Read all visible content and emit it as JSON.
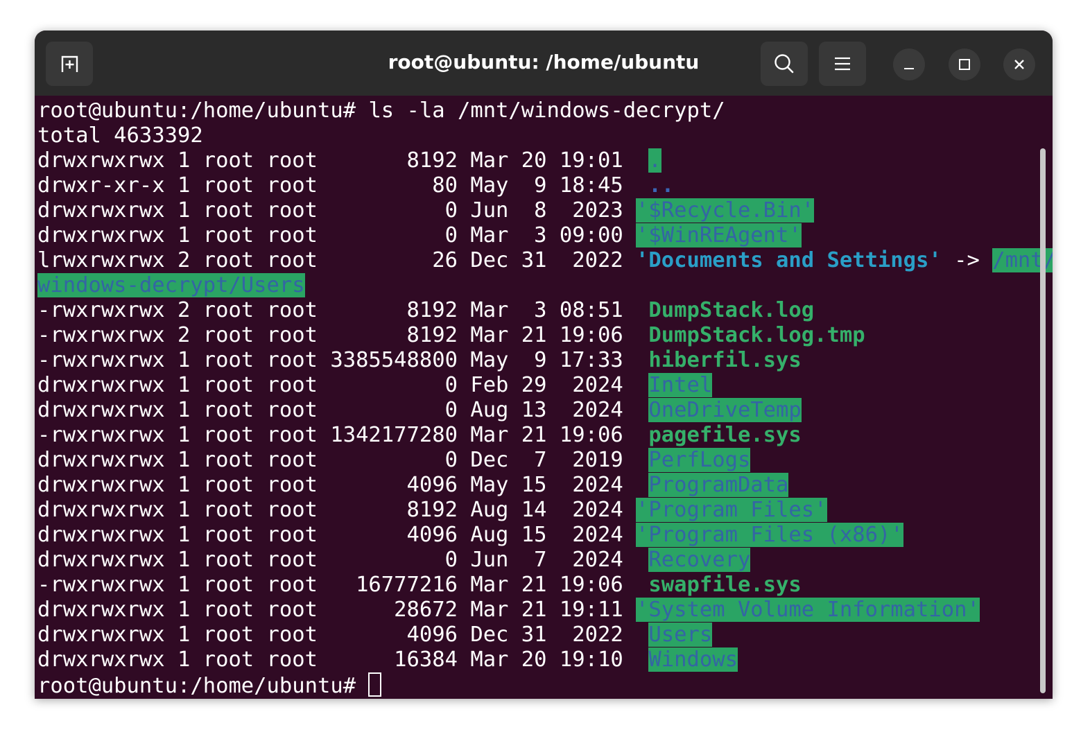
{
  "window": {
    "title": "root@ubuntu: /home/ubuntu",
    "buttons": [
      "new-tab",
      "search",
      "menu",
      "minimize",
      "maximize",
      "close"
    ]
  },
  "terminal": {
    "prompt": "root@ubuntu:/home/ubuntu# ",
    "command": "ls -la /mnt/windows-decrypt/",
    "total": "total 4633392",
    "rows": [
      {
        "meta": "drwxrwxrwx 1 root root       8192 Mar 20 19:01 ",
        "pre": " ",
        "name": ".",
        "style": "d"
      },
      {
        "meta": "drwxr-xr-x 1 root root         80 May  9 18:45 ",
        "pre": " ",
        "name": "..",
        "style": "b"
      },
      {
        "meta": "drwxrwxrwx 1 root root          0 Jun  8  2023 ",
        "pre": "",
        "name": "'$Recycle.Bin'",
        "style": "d"
      },
      {
        "meta": "drwxrwxrwx 1 root root          0 Mar  3 09:00 ",
        "pre": "",
        "name": "'$WinREAgent'",
        "style": "d"
      },
      {
        "meta": "lrwxrwxrwx 2 root root         26 Dec 31  2022 ",
        "pre": "",
        "name": "'Documents and Settings'",
        "style": "l",
        "arrow": " -> ",
        "target1": "/mnt/",
        "target2": "windows-decrypt/Users"
      },
      {
        "meta": "-rwxrwxrwx 2 root root       8192 Mar  3 08:51 ",
        "pre": " ",
        "name": "DumpStack.log",
        "style": "g"
      },
      {
        "meta": "-rwxrwxrwx 2 root root       8192 Mar 21 19:06 ",
        "pre": " ",
        "name": "DumpStack.log.tmp",
        "style": "g"
      },
      {
        "meta": "-rwxrwxrwx 1 root root 3385548800 May  9 17:33 ",
        "pre": " ",
        "name": "hiberfil.sys",
        "style": "g"
      },
      {
        "meta": "drwxrwxrwx 1 root root          0 Feb 29  2024 ",
        "pre": " ",
        "name": "Intel",
        "style": "d"
      },
      {
        "meta": "drwxrwxrwx 1 root root          0 Aug 13  2024 ",
        "pre": " ",
        "name": "OneDriveTemp",
        "style": "d"
      },
      {
        "meta": "-rwxrwxrwx 1 root root 1342177280 Mar 21 19:06 ",
        "pre": " ",
        "name": "pagefile.sys",
        "style": "g"
      },
      {
        "meta": "drwxrwxrwx 1 root root          0 Dec  7  2019 ",
        "pre": " ",
        "name": "PerfLogs",
        "style": "d"
      },
      {
        "meta": "drwxrwxrwx 1 root root       4096 May 15  2024 ",
        "pre": " ",
        "name": "ProgramData",
        "style": "d"
      },
      {
        "meta": "drwxrwxrwx 1 root root       8192 Aug 14  2024 ",
        "pre": "",
        "name": "'Program Files'",
        "style": "d"
      },
      {
        "meta": "drwxrwxrwx 1 root root       4096 Aug 15  2024 ",
        "pre": "",
        "name": "'Program Files (x86)'",
        "style": "d"
      },
      {
        "meta": "drwxrwxrwx 1 root root          0 Jun  7  2024 ",
        "pre": " ",
        "name": "Recovery",
        "style": "d"
      },
      {
        "meta": "-rwxrwxrwx 1 root root   16777216 Mar 21 19:06 ",
        "pre": " ",
        "name": "swapfile.sys",
        "style": "g"
      },
      {
        "meta": "drwxrwxrwx 1 root root      28672 Mar 21 19:11 ",
        "pre": "",
        "name": "'System Volume Information'",
        "style": "d"
      },
      {
        "meta": "drwxrwxrwx 1 root root       4096 Dec 31  2022 ",
        "pre": " ",
        "name": "Users",
        "style": "d"
      },
      {
        "meta": "drwxrwxrwx 1 root root      16384 Mar 20 19:10 ",
        "pre": " ",
        "name": "Windows",
        "style": "d"
      }
    ]
  },
  "colors": {
    "terminal_bg": "#300a24",
    "titlebar_bg": "#2b2b2b",
    "dir_fg": "#3465a4",
    "dir_highlight_bg": "#2aa464",
    "exec_fg": "#35b06a",
    "link_fg": "#2a9fc7"
  }
}
